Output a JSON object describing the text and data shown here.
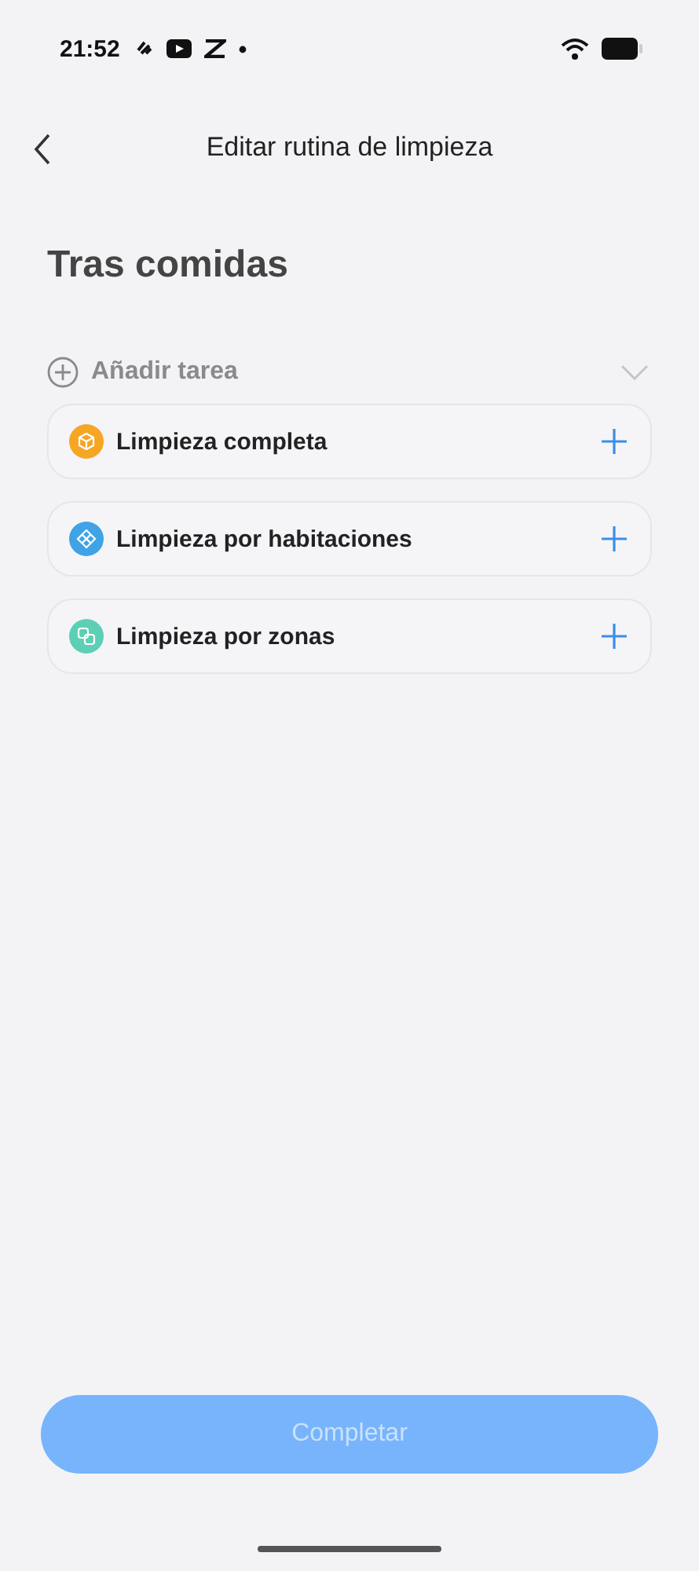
{
  "status_bar": {
    "time": "21:52"
  },
  "header": {
    "title": "Editar rutina de limpieza"
  },
  "routine": {
    "name": "Tras comidas"
  },
  "add_task": {
    "label": "Añadir tarea",
    "expanded": false
  },
  "tasks": [
    {
      "label": "Limpieza completa",
      "kind": "full",
      "color": "#f5a623"
    },
    {
      "label": "Limpieza por habitaciones",
      "kind": "rooms",
      "color": "#3fa3e6"
    },
    {
      "label": "Limpieza por zonas",
      "kind": "zones",
      "color": "#5ccfb4"
    }
  ],
  "complete_button": {
    "label": "Completar",
    "disabled": true
  }
}
